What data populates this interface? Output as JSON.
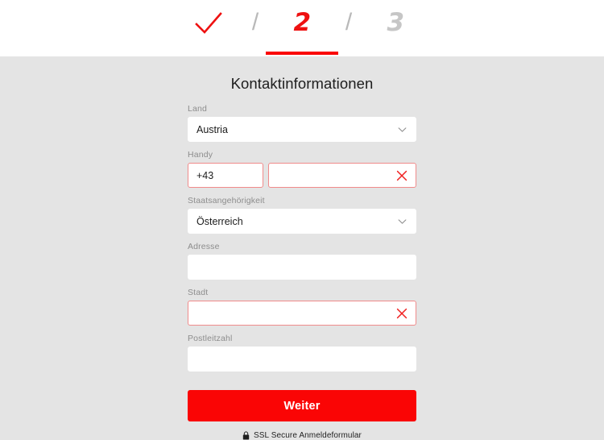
{
  "stepper": {
    "steps": [
      {
        "id": "step-1",
        "label": "check-mark",
        "state": "completed"
      },
      {
        "id": "step-2",
        "label": "2",
        "state": "active"
      },
      {
        "id": "step-3",
        "label": "3",
        "state": "upcoming"
      }
    ],
    "separator": "/",
    "active_color": "#ee1111",
    "inactive_color": "#c6c6c6",
    "underline_color": "#fa0505"
  },
  "form": {
    "title": "Kontaktinformationen",
    "fields": {
      "country": {
        "label": "Land",
        "value": "Austria",
        "placeholder": "",
        "icon": "chevron-down-icon",
        "error": false
      },
      "phone": {
        "label": "Handy",
        "prefix_value": "+43",
        "prefix_placeholder": "",
        "value": "",
        "placeholder": "",
        "icon": "error-x-icon",
        "error": true
      },
      "nationality": {
        "label": "Staatsangehörigkeit",
        "value": "Österreich",
        "placeholder": "",
        "icon": "chevron-down-icon",
        "error": false
      },
      "address": {
        "label": "Adresse",
        "value": "",
        "placeholder": "",
        "error": false
      },
      "city": {
        "label": "Stadt",
        "value": "",
        "placeholder": "",
        "icon": "error-x-icon",
        "error": true
      },
      "postal_code": {
        "label": "Postleitzahl",
        "value": "",
        "placeholder": "",
        "error": false
      }
    },
    "submit_label": "Weiter",
    "submit_color": "#fa0505"
  },
  "footer": {
    "ssl_text": "SSL Secure Anmeldeformular",
    "icon": "lock-icon"
  },
  "theme": {
    "page_background": "#e4e4e4",
    "header_background": "#ffffff",
    "field_background": "#ffffff",
    "label_color": "#8d8d8d",
    "error_border": "#f08b8b",
    "error_icon": "#f02020"
  }
}
